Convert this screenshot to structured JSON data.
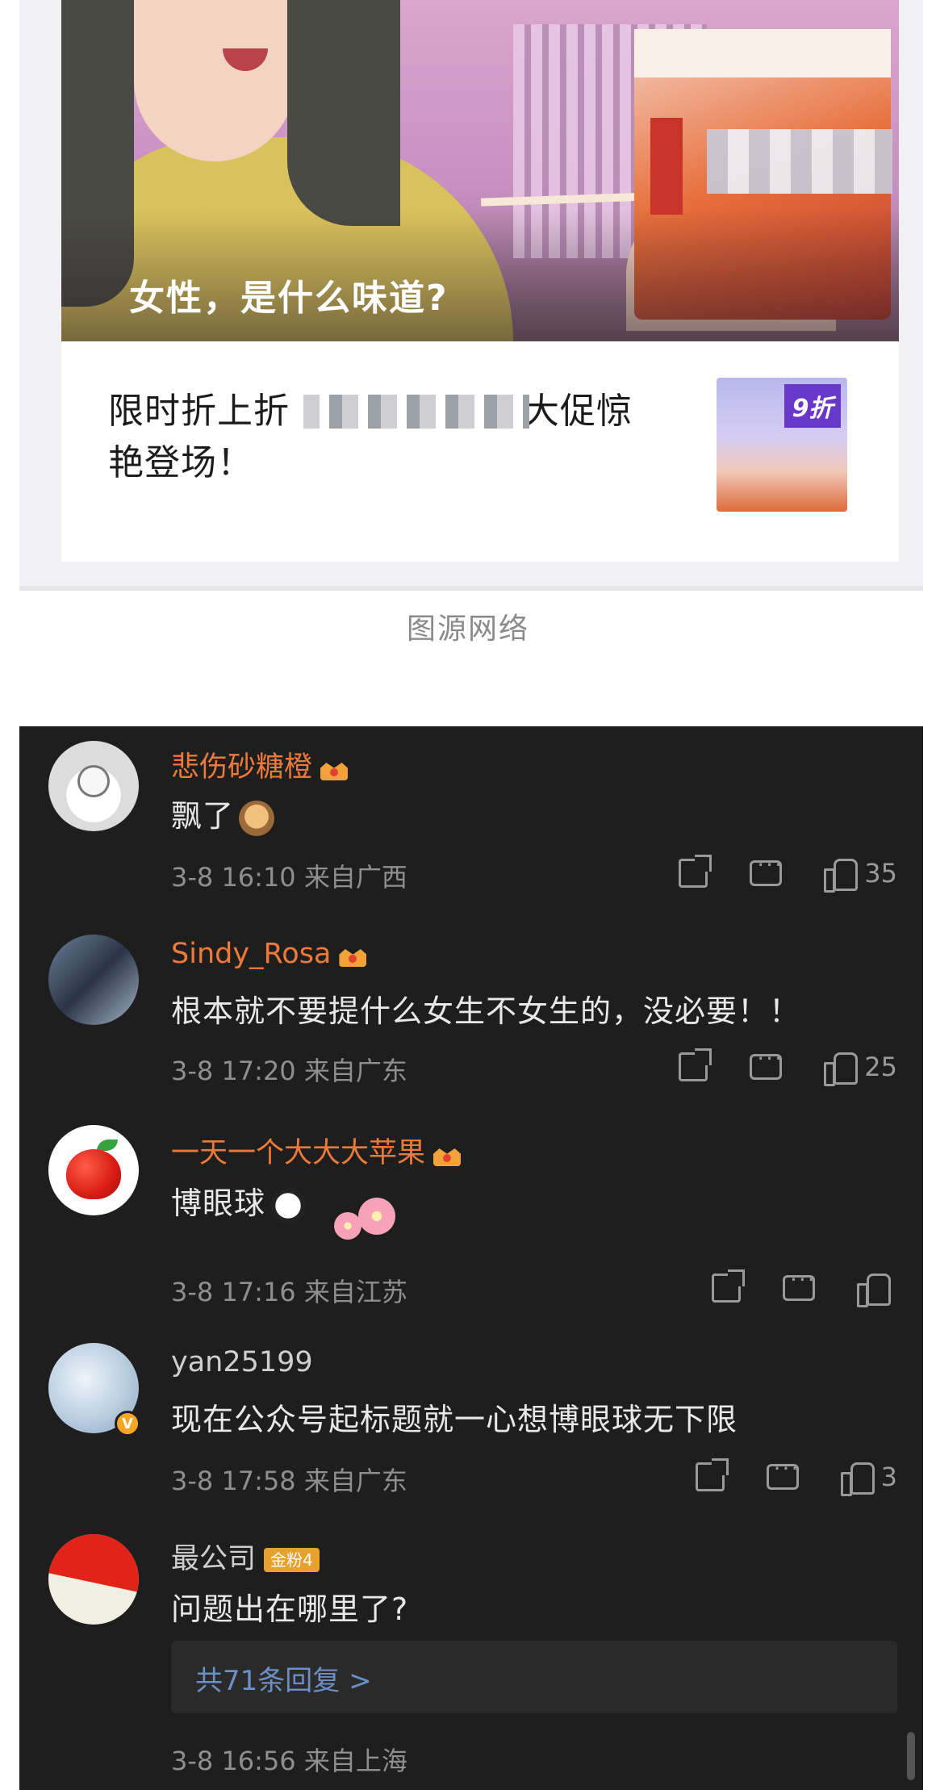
{
  "article": {
    "banner_title": "女性，是什么味道?",
    "title_line1_start": "限时折上折",
    "title_line1_end": "大促惊",
    "title_line2": "艳登场！",
    "thumb_badge": "9折",
    "caption": "图源网络"
  },
  "comments": [
    {
      "username": "悲伤砂糖橙",
      "badge": "crown",
      "text": "飘了",
      "emoji": "monkey-emoji",
      "time": "3-8 16:10",
      "location": "来自广西",
      "likes": "35"
    },
    {
      "username": "Sindy_Rosa",
      "badge": "crown",
      "text": "根本就不要提什么女生不女生的，没必要！！",
      "time": "3-8 17:20",
      "location": "来自广东",
      "likes": "25"
    },
    {
      "username": "一天一个大大大苹果",
      "badge": "crown",
      "text": "博眼球",
      "emoji": "panda-emoji",
      "time": "3-8 17:16",
      "location": "来自江苏",
      "likes": ""
    },
    {
      "username": "yan25199",
      "text": "现在公众号起标题就一心想博眼球无下限",
      "verified_mark": "V",
      "time": "3-8 17:58",
      "location": "来自广东",
      "likes": "3"
    },
    {
      "username": "最公司",
      "fan_badge": "金粉4",
      "text": "问题出在哪里了?",
      "replies_link": "共71条回复 >",
      "time": "3-8 16:56",
      "location": "来自上海"
    }
  ],
  "colors": {
    "username_accent": "#ee7a39",
    "panel_bg": "#1e1e1e",
    "reply_link": "#6c8fc6"
  }
}
